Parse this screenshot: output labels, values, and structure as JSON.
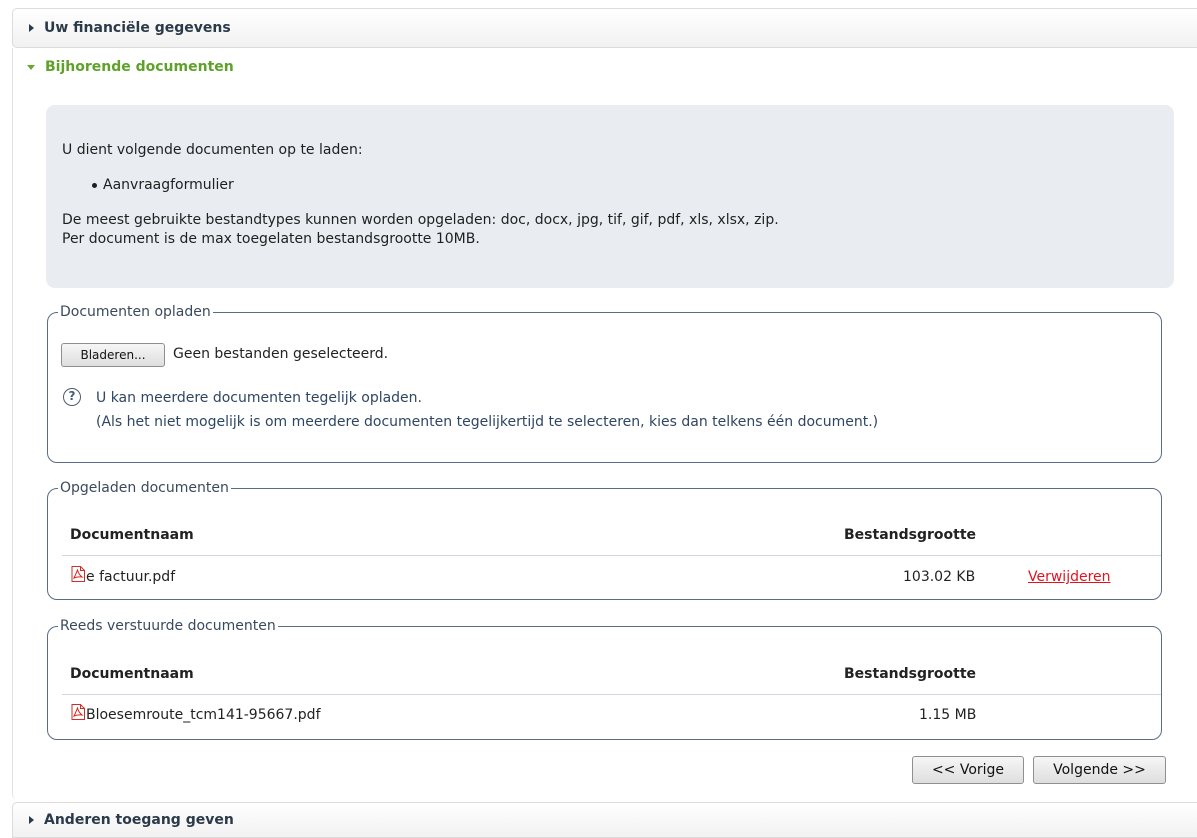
{
  "accordion": {
    "financial": "Uw financiële gegevens",
    "documents": "Bijhorende documenten",
    "access": "Anderen toegang geven"
  },
  "info": {
    "intro": "U dient volgende documenten op te laden:",
    "required_doc": "Aanvraagformulier",
    "types": "De meest gebruikte bestandtypes kunnen worden opgeladen: doc, docx, jpg, tif, gif, pdf, xls, xlsx, zip.",
    "maxsize": "Per document is de max toegelaten bestandsgrootte 10MB."
  },
  "upload": {
    "legend": "Documenten opladen",
    "browse_label": "Bladeren...",
    "no_file": "Geen bestanden geselecteerd.",
    "help_line1": "U kan meerdere documenten tegelijk opladen.",
    "help_line2": "(Als het niet mogelijk is om meerdere documenten tegelijkertijd te selecteren, kies dan telkens één document.)"
  },
  "uploaded": {
    "legend": "Opgeladen documenten",
    "col_name": "Documentnaam",
    "col_size": "Bestandsgrootte",
    "rows": [
      {
        "name": "e factuur.pdf",
        "size": "103.02 KB",
        "action": "Verwijderen"
      }
    ]
  },
  "sent": {
    "legend": "Reeds verstuurde documenten",
    "col_name": "Documentnaam",
    "col_size": "Bestandsgrootte",
    "rows": [
      {
        "name": "Bloesemroute_tcm141-95667.pdf",
        "size": "1.15 MB"
      }
    ]
  },
  "nav": {
    "prev": "<< Vorige",
    "next": "Volgende >>"
  },
  "colors": {
    "accent_green": "#5fa22a",
    "delete_red": "#e0141e"
  }
}
